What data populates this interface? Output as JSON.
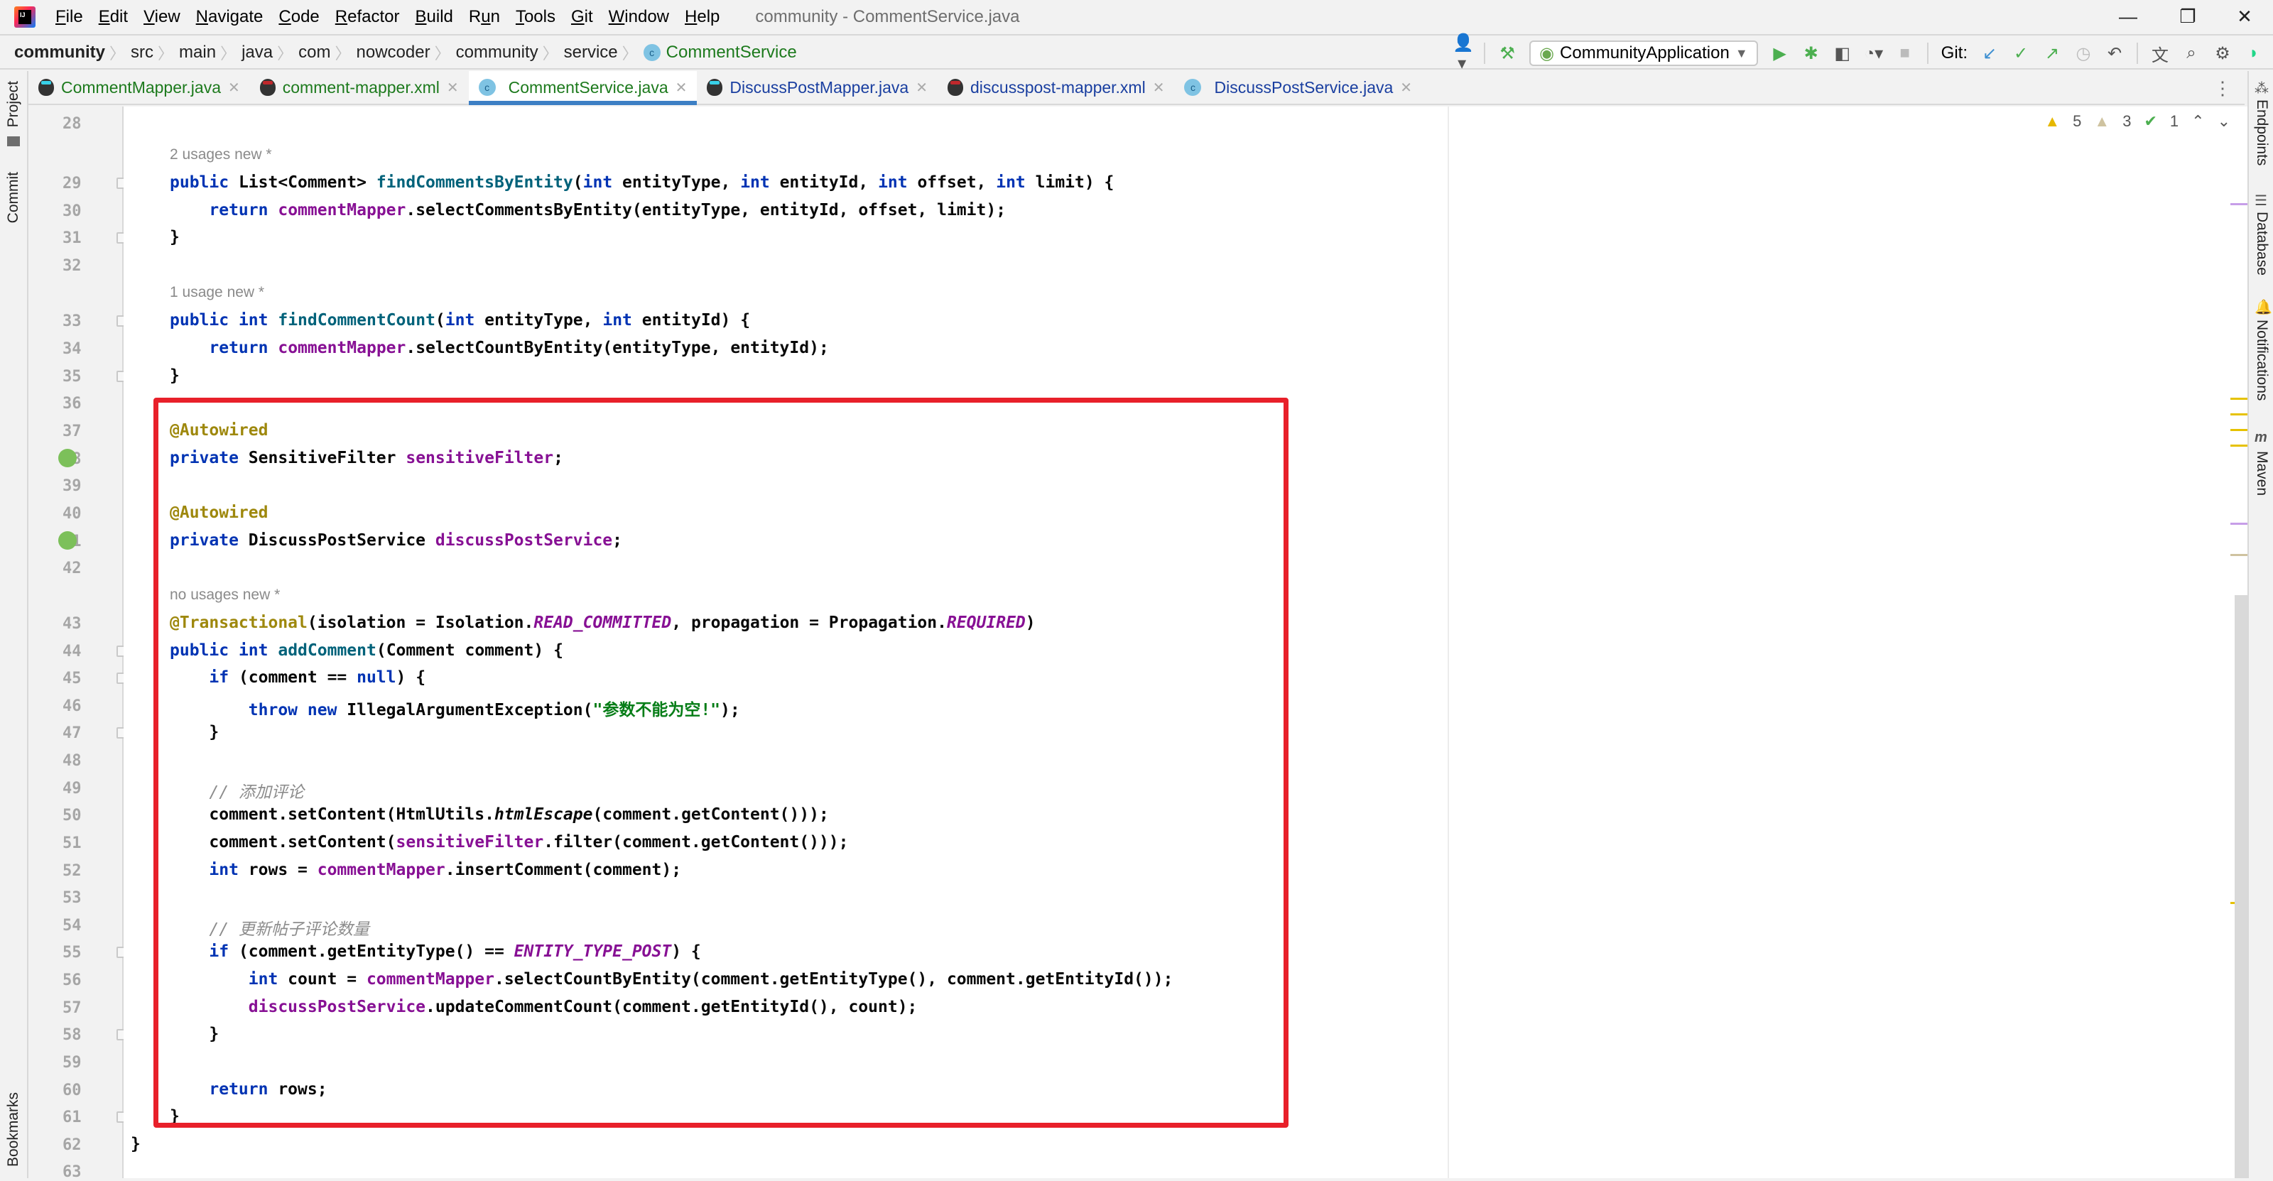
{
  "window": {
    "title": "community - CommentService.java",
    "controls": {
      "minimize": "—",
      "restore": "❐",
      "close": "✕"
    }
  },
  "menu": [
    {
      "key": "F",
      "rest": "ile"
    },
    {
      "key": "E",
      "rest": "dit"
    },
    {
      "key": "V",
      "rest": "iew"
    },
    {
      "key": "N",
      "rest": "avigate"
    },
    {
      "key": "C",
      "rest": "ode"
    },
    {
      "key": "R",
      "rest": "efactor"
    },
    {
      "key": "B",
      "rest": "uild"
    },
    {
      "key": "R",
      "pre": "",
      "rest": "un",
      "label": "Run"
    },
    {
      "key": "T",
      "rest": "ools"
    },
    {
      "key": "G",
      "rest": "it"
    },
    {
      "key": "W",
      "rest": "indow"
    },
    {
      "key": "H",
      "rest": "elp"
    }
  ],
  "breadcrumb": [
    "community",
    "src",
    "main",
    "java",
    "com",
    "nowcoder",
    "community",
    "service",
    "CommentService"
  ],
  "toolbar": {
    "run_config": "CommunityApplication",
    "git_label": "Git:",
    "icons": [
      "user-icon",
      "build-hammer-icon",
      "run-icon",
      "debug-icon",
      "coverage-icon",
      "profile-icon",
      "stop-icon",
      "git-update-icon",
      "git-commit-icon",
      "git-push-icon",
      "history-icon",
      "rollback-icon",
      "translate-icon",
      "search-icon",
      "settings-icon",
      "jetbrains-ai-icon"
    ]
  },
  "tabs": [
    {
      "label": "CommentMapper.java",
      "icon": "mybatis-mapper-icon",
      "color": "green",
      "active": false
    },
    {
      "label": "comment-mapper.xml",
      "icon": "mybatis-xml-icon",
      "color": "green",
      "active": false
    },
    {
      "label": "CommentService.java",
      "icon": "class-icon",
      "color": "green",
      "active": true
    },
    {
      "label": "DiscussPostMapper.java",
      "icon": "mybatis-mapper-icon",
      "color": "blue",
      "active": false
    },
    {
      "label": "discusspost-mapper.xml",
      "icon": "mybatis-xml-icon",
      "color": "blue",
      "active": false
    },
    {
      "label": "DiscussPostService.java",
      "icon": "class-icon",
      "color": "blue",
      "active": false
    }
  ],
  "left_tools": [
    "Project",
    "Commit",
    "Bookmarks"
  ],
  "right_tools": [
    "Endpoints",
    "Database",
    "Notifications",
    "Maven"
  ],
  "inspections": {
    "warnings": "5",
    "weak_warnings": "3",
    "typos": "1"
  },
  "code": {
    "hints": {
      "h29": "2 usages   new *",
      "h33": "1 usage   new *",
      "h43": "no usages   new *"
    },
    "lines": [
      {
        "n": "28"
      },
      {
        "n": "29",
        "html": "<span class='kw'>public</span> List&lt;Comment&gt; <span class='fn'>findCommentsByEntity</span>(<span class='kw'>int</span> entityType, <span class='kw'>int</span> entityId, <span class='kw'>int</span> offset, <span class='kw'>int</span> limit) {"
      },
      {
        "n": "30",
        "html": "    <span class='kw'>return</span> <span class='fld'>commentMapper</span>.selectCommentsByEntity(entityType, entityId, offset, limit);"
      },
      {
        "n": "31",
        "html": "}"
      },
      {
        "n": "32"
      },
      {
        "n": "33",
        "html": "<span class='kw'>public</span> <span class='kw'>int</span> <span class='fn'>findCommentCount</span>(<span class='kw'>int</span> entityType, <span class='kw'>int</span> entityId) {"
      },
      {
        "n": "34",
        "html": "    <span class='kw'>return</span> <span class='fld'>commentMapper</span>.selectCountByEntity(entityType, entityId);"
      },
      {
        "n": "35",
        "html": "}"
      },
      {
        "n": "36"
      },
      {
        "n": "37",
        "html": "<span class='ann'>@Autowired</span>"
      },
      {
        "n": "38",
        "html": "<span class='kw'>private</span> SensitiveFilter <span class='fld'>sensitiveFilter</span>;"
      },
      {
        "n": "39"
      },
      {
        "n": "40",
        "html": "<span class='ann'>@Autowired</span>"
      },
      {
        "n": "41",
        "html": "<span class='kw'>private</span> DiscussPostService <span class='fld'>discussPostService</span>;"
      },
      {
        "n": "42"
      },
      {
        "n": "43",
        "html": "<span class='ann'>@Transactional</span>(isolation = Isolation.<span class='const'>READ_COMMITTED</span>, propagation = Propagation.<span class='const'>REQUIRED</span>)"
      },
      {
        "n": "44",
        "html": "<span class='kw'>public</span> <span class='kw'>int</span> <span class='fn'>addComment</span>(Comment comment) {"
      },
      {
        "n": "45",
        "html": "    <span class='kw'>if</span> (comment == <span class='kw'>null</span>) {"
      },
      {
        "n": "46",
        "html": "        <span class='kw'>throw</span> <span class='kw'>new</span> IllegalArgumentException(<span class='str'>\"参数不能为空!\"</span>);"
      },
      {
        "n": "47",
        "html": "    }"
      },
      {
        "n": "48"
      },
      {
        "n": "49",
        "html": "    <span class='cmt'>// 添加评论</span>"
      },
      {
        "n": "50",
        "html": "    comment.setContent(HtmlUtils.<i>htmlEscape</i>(comment.getContent()));"
      },
      {
        "n": "51",
        "html": "    comment.setContent(<span class='fld'>sensitiveFilter</span>.filter(comment.getContent()));"
      },
      {
        "n": "52",
        "html": "    <span class='kw'>int</span> rows = <span class='fld'>commentMapper</span>.insertComment(comment);"
      },
      {
        "n": "53"
      },
      {
        "n": "54",
        "html": "    <span class='cmt'>// 更新帖子评论数量</span>"
      },
      {
        "n": "55",
        "html": "    <span class='kw'>if</span> (comment.getEntityType() == <span class='const'>ENTITY_TYPE_POST</span>) {"
      },
      {
        "n": "56",
        "html": "        <span class='kw'>int</span> count = <span class='fld'>commentMapper</span>.selectCountByEntity(comment.getEntityType(), comment.getEntityId());"
      },
      {
        "n": "57",
        "html": "        <span class='fld'>discussPostService</span>.updateCommentCount(comment.getEntityId(), count);"
      },
      {
        "n": "58",
        "html": "    }"
      },
      {
        "n": "59"
      },
      {
        "n": "60",
        "html": "    <span class='kw'>return</span> rows;"
      },
      {
        "n": "61",
        "html": "}"
      },
      {
        "n": "62",
        "html": "}"
      },
      {
        "n": "63"
      }
    ]
  },
  "annotation_box": {
    "color": "#e8202a",
    "covers_lines": "37-61"
  }
}
